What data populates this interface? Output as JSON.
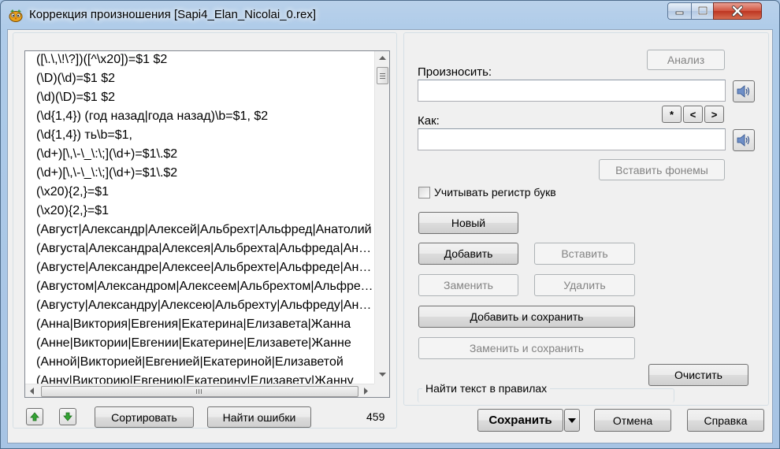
{
  "window": {
    "title": "Коррекция произношения [Sapi4_Elan_Nicolai_0.rex]"
  },
  "rules": [
    "([\\.\\,\\!\\?])([^\\x20])=$1 $2",
    "(\\D)(\\d)=$1 $2",
    "(\\d)(\\D)=$1 $2",
    "(\\d{1,4}) (год назад|года назад)\\b=$1, $2",
    "(\\d{1,4}) ть\\b=$1,",
    "(\\d+)[\\,\\-\\_\\:\\;](\\d+)=$1\\.$2",
    "(\\d+)[\\,\\-\\_\\:\\;](\\d+)=$1\\.$2",
    "(\\x20){2,}=$1",
    "(\\x20){2,}=$1",
    "(Август|Александр|Алексей|Альбрехт|Альфред|Анатолий",
    "(Августа|Александра|Алексея|Альбрехта|Альфреда|Анатолия",
    "(Августе|Александре|Алексее|Альбрехте|Альфреде|Анатолии",
    "(Августом|Александром|Алексеем|Альбрехтом|Альфредом",
    "(Августу|Александру|Алексею|Альбрехту|Альфреду|Анатолию",
    "(Анна|Виктория|Евгения|Екатерина|Елизавета|Жанна",
    "(Анне|Виктории|Евгении|Екатерине|Елизавете|Жанне",
    "(Анной|Викторией|Евгенией|Екатериной|Елизаветой",
    "(Анну|Викторию|Евгению|Екатерину|Елизавету|Жанну"
  ],
  "left": {
    "sort_label": "Сортировать",
    "find_errors_label": "Найти ошибки",
    "count": "459"
  },
  "right": {
    "analyze_label": "Анализ",
    "pronounce_label": "Произносить:",
    "pronounce_value": "",
    "how_label": "Как:",
    "how_value": "",
    "star_label": "*",
    "prev_label": "<",
    "next_label": ">",
    "insert_phonemes_label": "Вставить фонемы",
    "case_label": "Учитывать регистр букв",
    "new_label": "Новый",
    "add_label": "Добавить",
    "insert_label": "Вставить",
    "replace_label": "Заменить",
    "delete_label": "Удалить",
    "add_save_label": "Добавить и сохранить",
    "replace_save_label": "Заменить и сохранить",
    "clear_label": "Очистить",
    "find_text_label": "Найти текст в правилах"
  },
  "bottom": {
    "save_label": "Сохранить",
    "cancel_label": "Отмена",
    "help_label": "Справка"
  },
  "icons": {
    "app": "parrot-icon",
    "speaker": "speaker-icon",
    "up": "arrow-up-icon",
    "down": "arrow-down-icon"
  }
}
